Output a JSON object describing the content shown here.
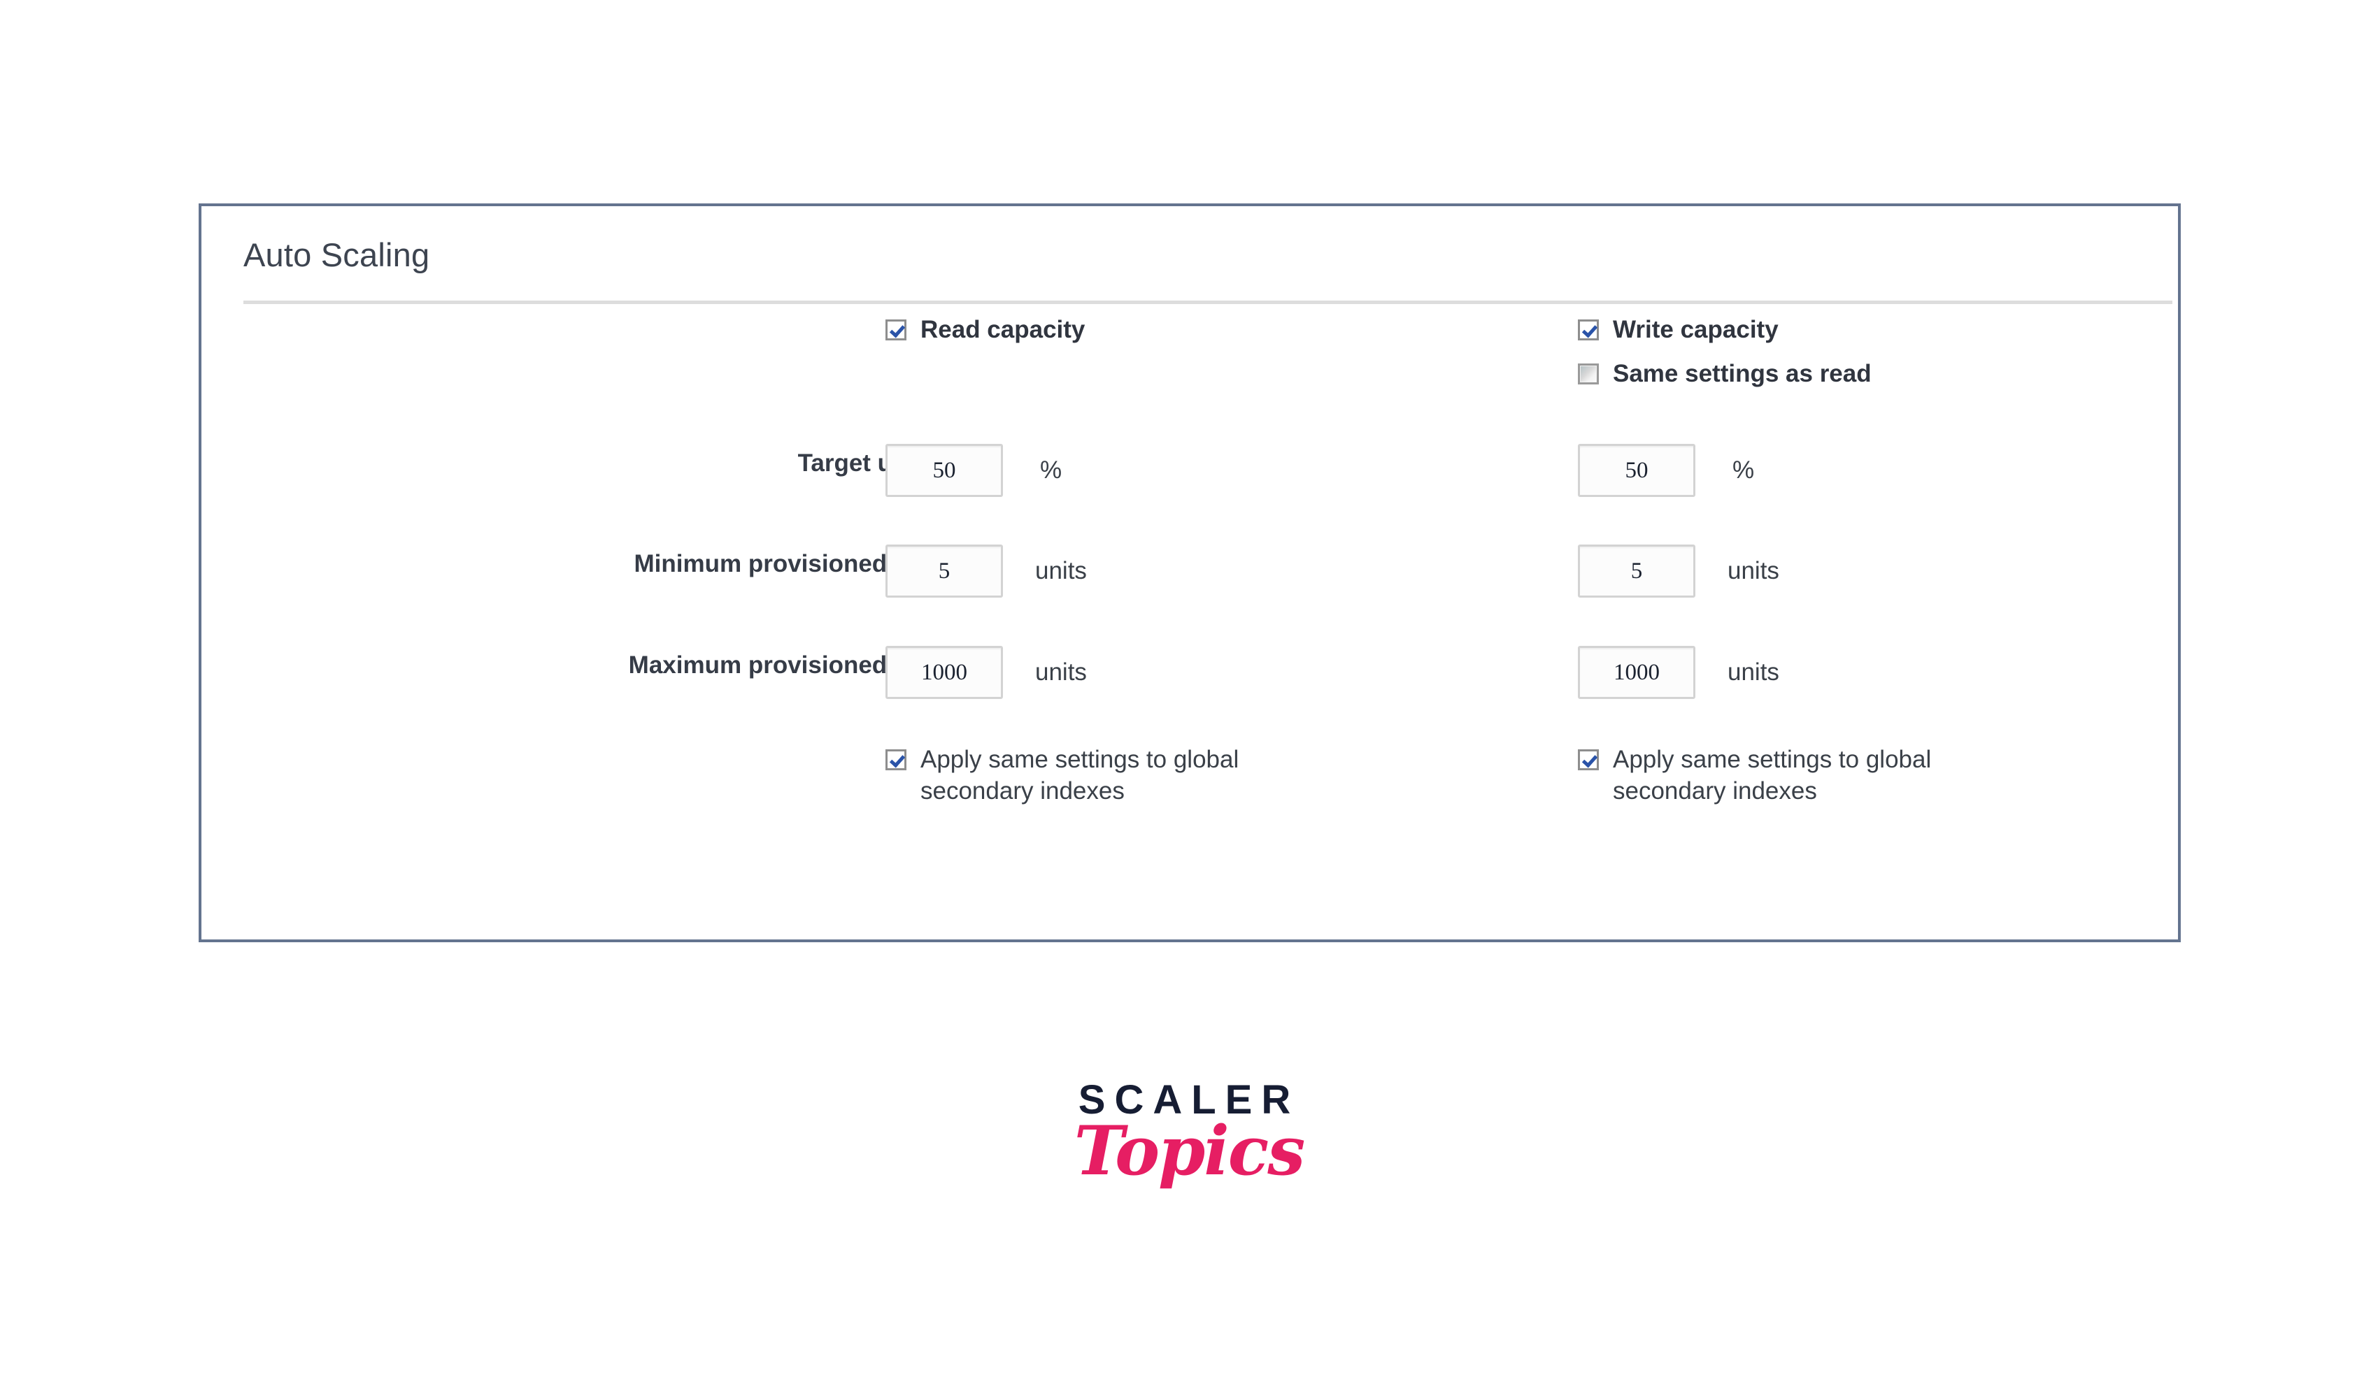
{
  "panel": {
    "title": "Auto Scaling"
  },
  "columns": {
    "read": {
      "toggle_label": "Read capacity",
      "toggle_checked": true,
      "target_utilization": "50",
      "target_utilization_unit": "%",
      "minimum_capacity": "5",
      "minimum_capacity_unit": "units",
      "maximum_capacity": "1000",
      "maximum_capacity_unit": "units",
      "apply_gsi_label": "Apply same settings to global secondary indexes",
      "apply_gsi_checked": true
    },
    "write": {
      "toggle_label": "Write capacity",
      "toggle_checked": true,
      "same_as_read_label": "Same settings as read",
      "same_as_read_checked": false,
      "target_utilization": "50",
      "target_utilization_unit": "%",
      "minimum_capacity": "5",
      "minimum_capacity_unit": "units",
      "maximum_capacity": "1000",
      "maximum_capacity_unit": "units",
      "apply_gsi_label": "Apply same settings to global secondary indexes",
      "apply_gsi_checked": true
    }
  },
  "row_labels": {
    "target_utilization": "Target utilization",
    "minimum_capacity": "Minimum provisioned capacity",
    "maximum_capacity": "Maximum provisioned capacity"
  },
  "logo": {
    "primary": "SCALER",
    "secondary": "Topics",
    "primary_color": "#161d33",
    "secondary_color": "#e61e63"
  },
  "colors": {
    "panel_border": "#64748f",
    "divider": "#dddddd",
    "title_text": "#3d4450",
    "label_text": "#363c47",
    "checkmark": "#2a53a8"
  }
}
